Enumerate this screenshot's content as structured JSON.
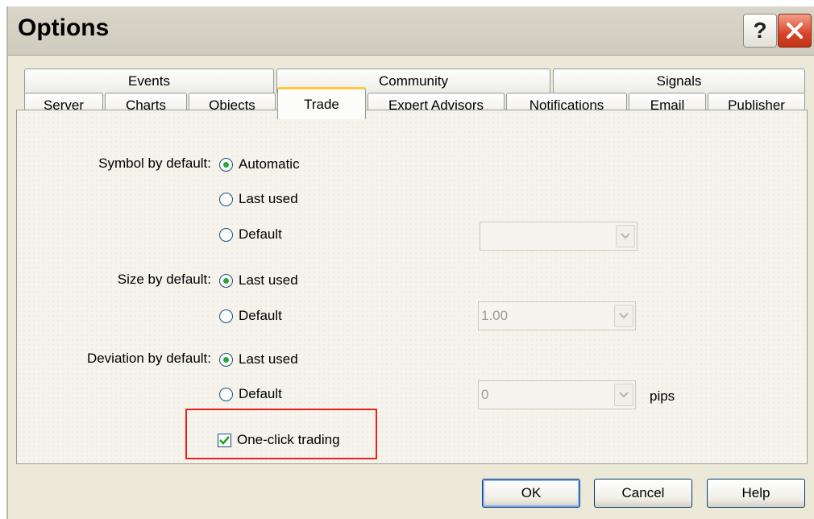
{
  "window": {
    "title": "Options",
    "help_glyph": "?",
    "close_glyph": "✕"
  },
  "tabs_row1": [
    "Events",
    "Community",
    "Signals"
  ],
  "tabs_row2": [
    "Server",
    "Charts",
    "Objects",
    "Trade",
    "Expert Advisors",
    "Notifications",
    "Email",
    "Publisher"
  ],
  "active_tab": "Trade",
  "trade": {
    "symbol": {
      "label": "Symbol by default:",
      "options": [
        "Automatic",
        "Last used",
        "Default"
      ],
      "selected": "Automatic",
      "combo_value": ""
    },
    "size": {
      "label": "Size by default:",
      "options": [
        "Last used",
        "Default"
      ],
      "selected": "Last used",
      "combo_value": "1.00"
    },
    "deviation": {
      "label": "Deviation by default:",
      "options": [
        "Last used",
        "Default"
      ],
      "selected": "Last used",
      "combo_value": "0",
      "unit": "pips"
    },
    "one_click": {
      "label": "One-click trading",
      "checked": true
    }
  },
  "buttons": {
    "ok": "OK",
    "cancel": "Cancel",
    "help": "Help"
  },
  "colors": {
    "highlight": "#e8231d",
    "radio_selected": "#2fa336",
    "active_tab_accent": "#ffc73c"
  },
  "icons": {
    "combo_arrow": "chevron-down-icon",
    "check": "checkmark-icon"
  }
}
